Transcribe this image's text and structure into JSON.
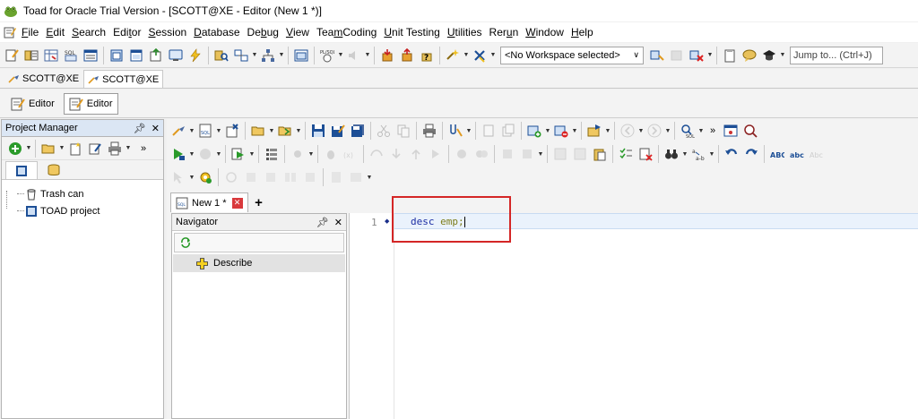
{
  "window": {
    "title": "Toad for Oracle Trial Version - [SCOTT@XE - Editor (New 1 *)]"
  },
  "menu": {
    "items": [
      {
        "label": "File",
        "u": "F",
        "rest": "ile"
      },
      {
        "label": "Edit",
        "u": "E",
        "rest": "dit"
      },
      {
        "label": "Search",
        "u": "S",
        "rest": "earch"
      },
      {
        "label": "Editor",
        "pre": "Edi",
        "u": "t",
        "rest": "or"
      },
      {
        "label": "Session",
        "u": "S",
        "rest": "ession"
      },
      {
        "label": "Database",
        "u": "D",
        "rest": "atabase"
      },
      {
        "label": "Debug",
        "pre": "De",
        "u": "b",
        "rest": "ug"
      },
      {
        "label": "View",
        "u": "V",
        "rest": "iew"
      },
      {
        "label": "Team Coding",
        "pre": "Tea",
        "u": "m",
        "rest": " Coding"
      },
      {
        "label": "Unit Testing",
        "u": "U",
        "rest": "nit Testing"
      },
      {
        "label": "Utilities",
        "u": "U",
        "rest": "tilities"
      },
      {
        "label": "Rerun",
        "pre": "Rer",
        "u": "u",
        "rest": "n"
      },
      {
        "label": "Window",
        "u": "W",
        "rest": "indow"
      },
      {
        "label": "Help",
        "u": "H",
        "rest": "elp"
      }
    ]
  },
  "toolbar": {
    "workspace_select": "<No Workspace selected>",
    "jump_placeholder": "Jump to... (Ctrl+J)"
  },
  "connection_tabs": [
    "SCOTT@XE",
    "SCOTT@XE"
  ],
  "editor_tabs": [
    "Editor",
    "Editor"
  ],
  "project_manager": {
    "title": "Project Manager",
    "tree": [
      "Trash can",
      "TOAD project"
    ]
  },
  "sql_tab": {
    "label": "New 1 *",
    "add": "+"
  },
  "navigator": {
    "title": "Navigator",
    "items": [
      "Describe"
    ]
  },
  "editor": {
    "line_number": "1",
    "keyword": "desc",
    "identifier": "emp;"
  },
  "colors": {
    "highlight_box": "#d42626",
    "keyword": "#1b2da3",
    "identifier": "#7c7c18",
    "current_line": "#eaf2fc"
  }
}
